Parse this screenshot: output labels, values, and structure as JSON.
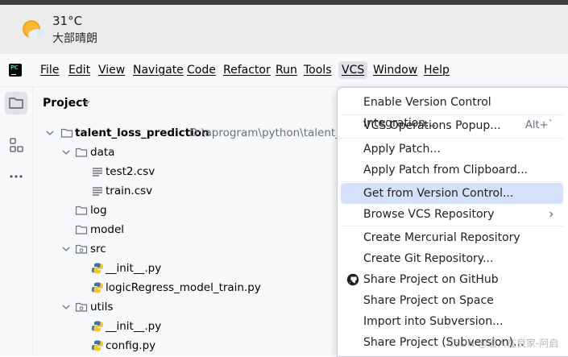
{
  "weather": {
    "temperature": "31°C",
    "description": "大部晴朗"
  },
  "menu": {
    "items": [
      {
        "label": "File"
      },
      {
        "label": "Edit"
      },
      {
        "label": "View"
      },
      {
        "label": "Navigate"
      },
      {
        "label": "Code"
      },
      {
        "label": "Refactor"
      },
      {
        "label": "Run"
      },
      {
        "label": "Tools"
      },
      {
        "label": "VCS"
      },
      {
        "label": "Window"
      },
      {
        "label": "Help"
      }
    ],
    "active": "VCS"
  },
  "sidebar": {
    "icons": [
      "folder-icon",
      "structure-icon",
      "more-icon"
    ]
  },
  "project": {
    "title": "Project",
    "tree": [
      {
        "label": "talent_loss_prediction",
        "path": "D:\\aprogram\\python\\talent_lo",
        "type": "folder",
        "bold": true
      },
      {
        "label": "data",
        "type": "folder"
      },
      {
        "label": "test2.csv",
        "type": "file-text"
      },
      {
        "label": "train.csv",
        "type": "file-text"
      },
      {
        "label": "log",
        "type": "folder"
      },
      {
        "label": "model",
        "type": "folder"
      },
      {
        "label": "src",
        "type": "package"
      },
      {
        "label": "__init__.py",
        "type": "python"
      },
      {
        "label": "logicRegress_model_train.py",
        "type": "python"
      },
      {
        "label": "utils",
        "type": "package"
      },
      {
        "label": "__init__.py",
        "type": "python"
      },
      {
        "label": "config.py",
        "type": "python"
      }
    ]
  },
  "vcs_menu": {
    "items": [
      {
        "label": "Enable Version Control Integration..."
      },
      {
        "label": "VCS Operations Popup...",
        "shortcut": "Alt+`"
      },
      {
        "label": "Apply Patch..."
      },
      {
        "label": "Apply Patch from Clipboard..."
      },
      {
        "label": "Get from Version Control...",
        "selected": true
      },
      {
        "label": "Browse VCS Repository",
        "submenu": true
      },
      {
        "label": "Create Mercurial Repository"
      },
      {
        "label": "Create Git Repository..."
      },
      {
        "label": "Share Project on GitHub",
        "icon": "github-icon"
      },
      {
        "label": "Share Project on Space"
      },
      {
        "label": "Import into Subversion..."
      },
      {
        "label": "Share Project (Subversion)..."
      }
    ]
  },
  "watermark": "CSDN @通人在良家-阿启",
  "colors": {
    "selection": "#d5e1fb",
    "menu_active": "#dfe1e5",
    "panel_bg": "#f7f8fa"
  }
}
